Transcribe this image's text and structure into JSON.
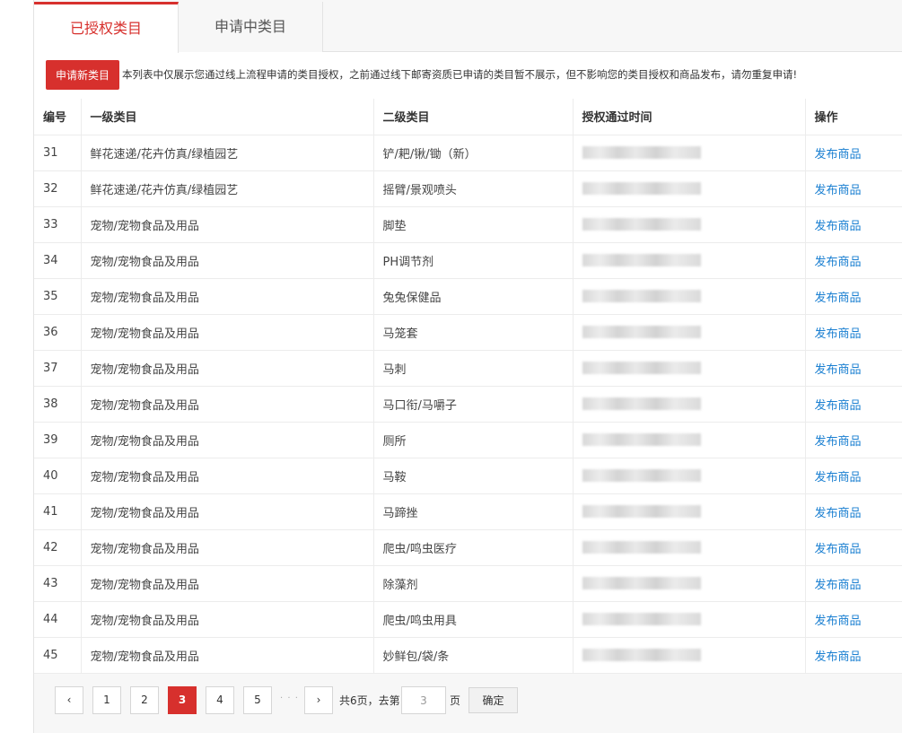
{
  "tabs": [
    {
      "label": "已授权类目"
    },
    {
      "label": "申请中类目"
    }
  ],
  "apply_button": "申请新类目",
  "notice": "本列表中仅展示您通过线上流程申请的类目授权，之前通过线下邮寄资质已申请的类目暂不展示，但不影响您的类目授权和商品发布，请勿重复申请!",
  "table": {
    "headers": {
      "id": "编号",
      "l1": "一级类目",
      "l2": "二级类目",
      "time": "授权通过时间",
      "op": "操作"
    },
    "action_label": "发布商品",
    "rows": [
      {
        "id": "31",
        "l1": "鲜花速递/花卉仿真/绿植园艺",
        "l2": "铲/耙/锹/锄（新）"
      },
      {
        "id": "32",
        "l1": "鲜花速递/花卉仿真/绿植园艺",
        "l2": "摇臂/景观喷头"
      },
      {
        "id": "33",
        "l1": "宠物/宠物食品及用品",
        "l2": "脚垫"
      },
      {
        "id": "34",
        "l1": "宠物/宠物食品及用品",
        "l2": "PH调节剂"
      },
      {
        "id": "35",
        "l1": "宠物/宠物食品及用品",
        "l2": "兔兔保健品"
      },
      {
        "id": "36",
        "l1": "宠物/宠物食品及用品",
        "l2": "马笼套"
      },
      {
        "id": "37",
        "l1": "宠物/宠物食品及用品",
        "l2": "马刺"
      },
      {
        "id": "38",
        "l1": "宠物/宠物食品及用品",
        "l2": "马口衔/马嚼子"
      },
      {
        "id": "39",
        "l1": "宠物/宠物食品及用品",
        "l2": "厕所"
      },
      {
        "id": "40",
        "l1": "宠物/宠物食品及用品",
        "l2": "马鞍"
      },
      {
        "id": "41",
        "l1": "宠物/宠物食品及用品",
        "l2": "马蹄挫"
      },
      {
        "id": "42",
        "l1": "宠物/宠物食品及用品",
        "l2": "爬虫/鸣虫医疗"
      },
      {
        "id": "43",
        "l1": "宠物/宠物食品及用品",
        "l2": "除藻剂"
      },
      {
        "id": "44",
        "l1": "宠物/宠物食品及用品",
        "l2": "爬虫/鸣虫用具"
      },
      {
        "id": "45",
        "l1": "宠物/宠物食品及用品",
        "l2": "妙鲜包/袋/条"
      }
    ]
  },
  "pagination": {
    "prev": "‹",
    "next": "›",
    "pages": [
      "1",
      "2",
      "3",
      "4",
      "5"
    ],
    "current": "3",
    "ellipsis": "· · ·",
    "total_text": "共6页，去第",
    "page_suffix": "页",
    "input_value": "3",
    "confirm_label": "确定"
  },
  "colors": {
    "accent": "#d7302d",
    "link": "#1a7fd1"
  }
}
